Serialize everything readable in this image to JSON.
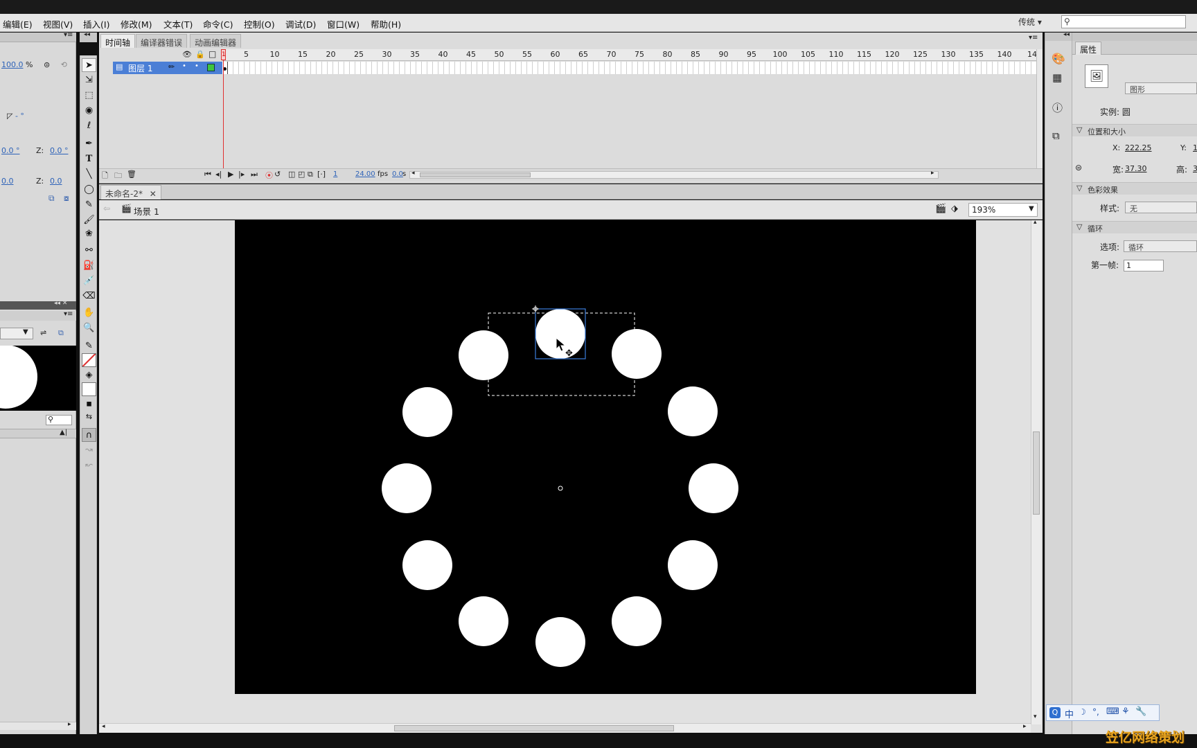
{
  "menubar": {
    "items": [
      "编辑(E)",
      "视图(V)",
      "插入(I)",
      "修改(M)",
      "文本(T)",
      "命令(C)",
      "控制(O)",
      "调试(D)",
      "窗口(W)",
      "帮助(H)"
    ],
    "workspace": "传统"
  },
  "left_panel": {
    "zoom_value": "100.0",
    "zoom_unit": "%",
    "skew_suffix": "- °",
    "x_rot": "0.0 °",
    "z_rot_label": "Z:",
    "z_rot": "0.0 °",
    "x_pos": "0.0",
    "z_pos_label": "Z:",
    "z_pos": "0.0"
  },
  "timeline": {
    "tabs": [
      "时间轴",
      "编译器错误",
      "动画编辑器"
    ],
    "ruler": [
      "5",
      "10",
      "15",
      "20",
      "25",
      "30",
      "35",
      "40",
      "45",
      "50",
      "55",
      "60",
      "65",
      "70",
      "75",
      "80",
      "85",
      "90",
      "95",
      "100",
      "105",
      "110",
      "115",
      "120",
      "125",
      "130",
      "135",
      "140",
      "14"
    ],
    "playhead_frame": "1",
    "layer_name": "图层 1",
    "current_frame": "1",
    "fps": "24.00",
    "fps_unit": "fps",
    "time": "0.0",
    "time_unit": "s"
  },
  "document": {
    "tab": "未命名-2*",
    "scene": "场景 1",
    "zoom": "193%"
  },
  "properties": {
    "tab": "属性",
    "type": "图形",
    "instance_label": "实例:",
    "instance_name": "圆",
    "section_position": "位置和大小",
    "x_label": "X:",
    "x_value": "222.25",
    "y_label": "Y:",
    "y_value": "1",
    "w_label": "宽:",
    "w_value": "37.30",
    "h_label": "高:",
    "h_value": "3",
    "section_color": "色彩效果",
    "style_label": "样式:",
    "style_value": "无",
    "section_loop": "循环",
    "option_label": "选项:",
    "option_value": "循环",
    "first_frame_label": "第一帧:",
    "first_frame_value": "1"
  },
  "ime": {
    "lang": "中"
  },
  "watermark": "笠亿网络策划",
  "colors": {
    "layer_selected": "#4b7fd6",
    "playhead": "#e03030",
    "link_blue": "#2d62b8"
  }
}
